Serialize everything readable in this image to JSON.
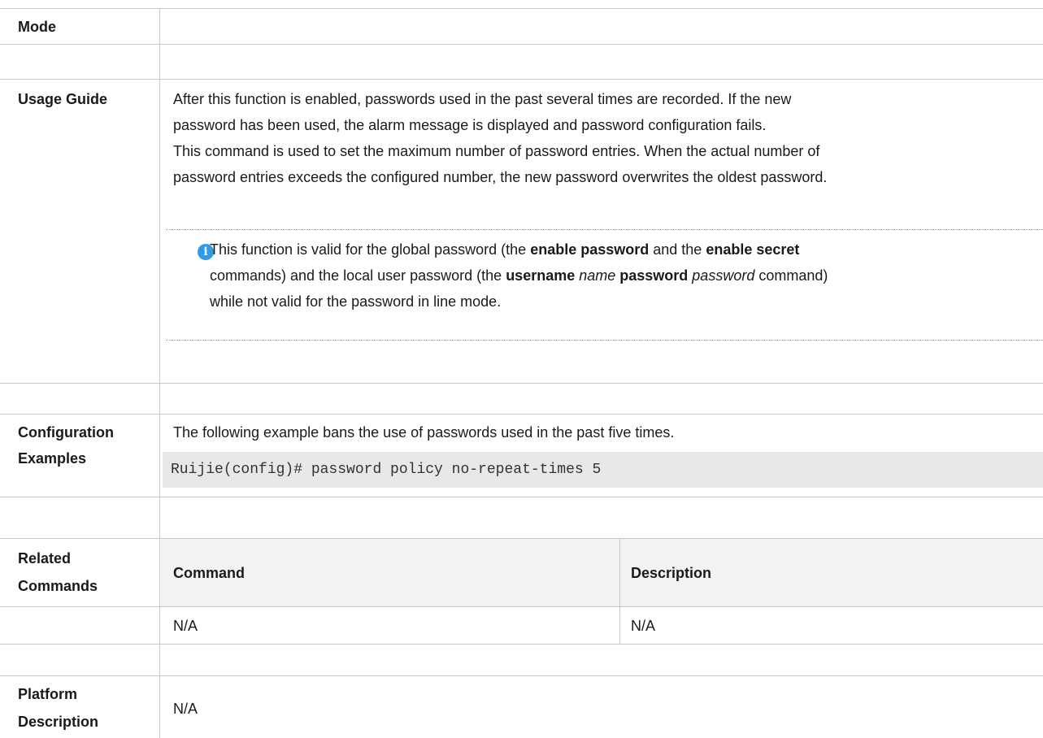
{
  "rows": {
    "mode": {
      "label": "Mode"
    },
    "usage": {
      "label": "Usage Guide",
      "lines": [
        "After this function is enabled, passwords used in the past several times are recorded. If the new",
        "password has been used, the alarm message is displayed and password configuration fails.",
        "This command is used to set the maximum number of password entries. When the actual number of",
        "password entries exceeds the configured number, the new password overwrites the oldest password."
      ],
      "note": {
        "icon": "info-icon",
        "l1_a": "This function is valid for the global password (the ",
        "l1_b": "enable password",
        "l1_c": " and the ",
        "l1_d": "enable secret",
        "l2_a": "commands) and the local user password (the ",
        "l2_b": "username",
        "l2_c": " name ",
        "l2_d": "password",
        "l2_e": " password",
        "l2_f": " command)",
        "l3": "while not valid for the password in line mode."
      }
    },
    "config": {
      "label_1": "Configuration",
      "label_2": "Examples",
      "text": "The following example bans the use of passwords used in the past five times.",
      "code": "Ruijie(config)# password policy no-repeat-times 5"
    },
    "related": {
      "label_1": "Related",
      "label_2": "Commands",
      "headers": [
        "Command",
        "Description"
      ],
      "cells": [
        "N/A",
        "N/A"
      ]
    },
    "platform": {
      "label_1": "Platform",
      "label_2": "Description",
      "text": "N/A"
    }
  },
  "colors": {
    "note_icon": "#2f9be6",
    "code_bg": "#e8e8e8",
    "border": "#c8c8c8"
  }
}
